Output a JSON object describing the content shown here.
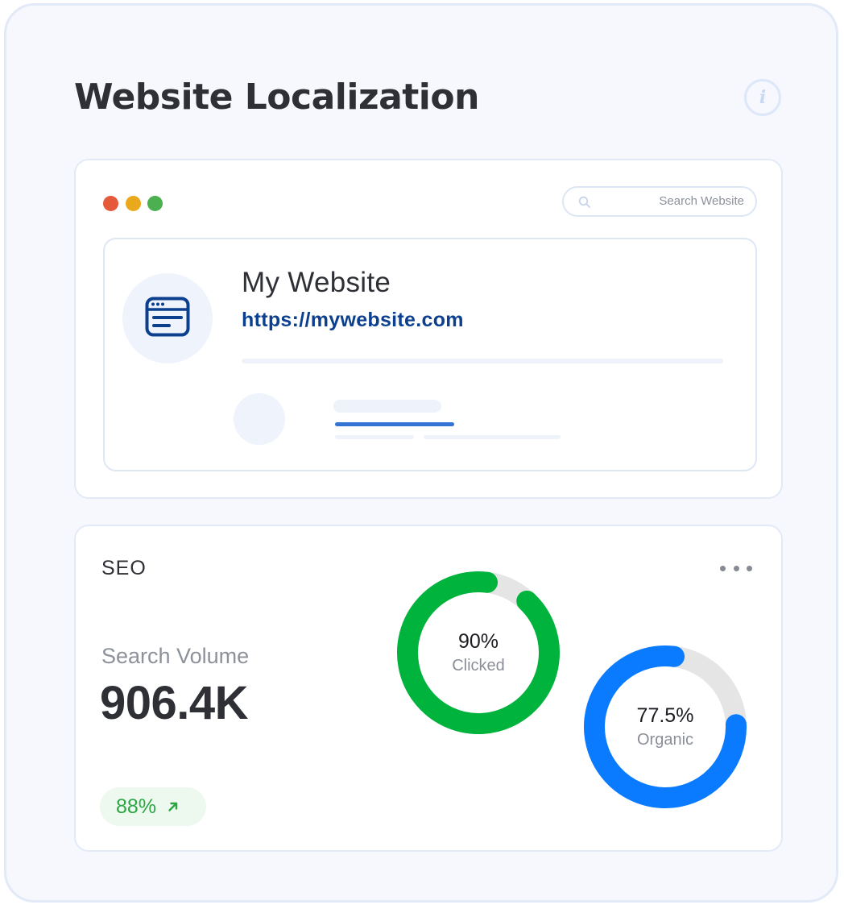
{
  "page": {
    "title": "Website Localization",
    "info_icon": "info-icon",
    "info_glyph": "i"
  },
  "browser": {
    "window_dots": [
      "#e65a3c",
      "#eaa81c",
      "#4caf50"
    ],
    "search": {
      "placeholder": "Search Website",
      "icon": "search-icon"
    },
    "site": {
      "name": "My Website",
      "url": "https://mywebsite.com",
      "icon": "browser-window-icon",
      "accent_color": "#0d3f8f"
    }
  },
  "seo": {
    "title": "SEO",
    "menu_icon": "more-horizontal-icon",
    "metric": {
      "label": "Search Volume",
      "value": "906.4K",
      "change": "88%",
      "change_icon": "arrow-up-right-icon",
      "change_color": "#2ca543"
    },
    "donuts": [
      {
        "value": 90,
        "value_label": "90%",
        "label": "Clicked",
        "color": "#00b33c",
        "track_color": "#e5e5e5"
      },
      {
        "value": 77.5,
        "value_label": "77.5%",
        "label": "Organic",
        "color": "#0a7bff",
        "track_color": "#e5e5e5"
      }
    ]
  }
}
